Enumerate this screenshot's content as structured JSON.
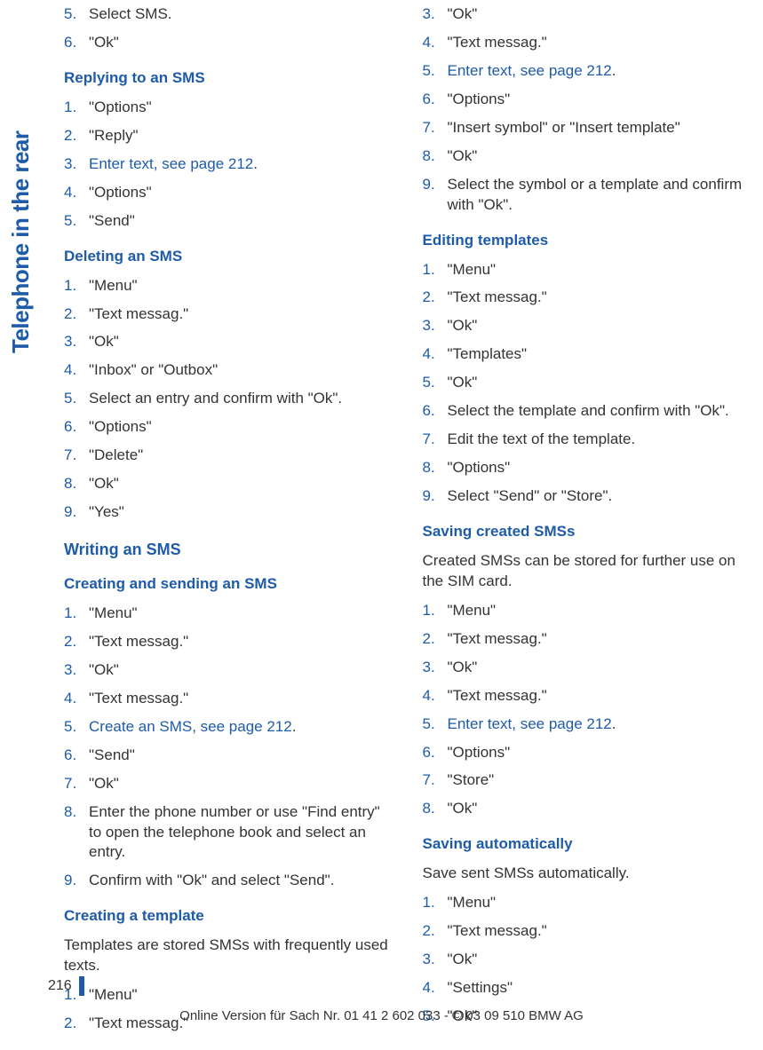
{
  "side_label": "Telephone in the rear",
  "col1": {
    "intro_list": [
      {
        "n": "5.",
        "t": "Select SMS."
      },
      {
        "n": "6.",
        "t": "\"Ok\""
      }
    ],
    "replying_heading": "Replying to an SMS",
    "replying_list": [
      {
        "n": "1.",
        "t": "\"Options\""
      },
      {
        "n": "2.",
        "t": "\"Reply\""
      },
      {
        "n": "3.",
        "link": "Enter text, see page 212",
        "suffix": "."
      },
      {
        "n": "4.",
        "t": "\"Options\""
      },
      {
        "n": "5.",
        "t": "\"Send\""
      }
    ],
    "deleting_heading": "Deleting an SMS",
    "deleting_list": [
      {
        "n": "1.",
        "t": "\"Menu\""
      },
      {
        "n": "2.",
        "t": "\"Text messag.\""
      },
      {
        "n": "3.",
        "t": "\"Ok\""
      },
      {
        "n": "4.",
        "t": "\"Inbox\" or \"Outbox\""
      },
      {
        "n": "5.",
        "t": "Select an entry and confirm with \"Ok\"."
      },
      {
        "n": "6.",
        "t": "\"Options\""
      },
      {
        "n": "7.",
        "t": "\"Delete\""
      },
      {
        "n": "8.",
        "t": "\"Ok\""
      },
      {
        "n": "9.",
        "t": "\"Yes\""
      }
    ],
    "writing_heading": "Writing an SMS",
    "creating_heading": "Creating and sending an SMS",
    "creating_list": [
      {
        "n": "1.",
        "t": "\"Menu\""
      },
      {
        "n": "2.",
        "t": "\"Text messag.\""
      },
      {
        "n": "3.",
        "t": "\"Ok\""
      },
      {
        "n": "4.",
        "t": "\"Text messag.\""
      },
      {
        "n": "5.",
        "link": "Create an SMS, see page 212",
        "suffix": "."
      },
      {
        "n": "6.",
        "t": "\"Send\""
      },
      {
        "n": "7.",
        "t": "\"Ok\""
      },
      {
        "n": "8.",
        "t": "Enter the phone number or use \"Find entry\" to open the telephone book and select an entry."
      },
      {
        "n": "9.",
        "t": "Confirm with \"Ok\" and select \"Send\"."
      }
    ],
    "template_heading": "Creating a template",
    "template_intro": "Templates are stored SMSs with frequently used texts.",
    "template_list": [
      {
        "n": "1.",
        "t": "\"Menu\""
      },
      {
        "n": "2.",
        "t": "\"Text messag.\""
      }
    ]
  },
  "col2": {
    "template_cont": [
      {
        "n": "3.",
        "t": "\"Ok\""
      },
      {
        "n": "4.",
        "t": "\"Text messag.\""
      },
      {
        "n": "5.",
        "link": "Enter text, see page 212",
        "suffix": "."
      },
      {
        "n": "6.",
        "t": "\"Options\""
      },
      {
        "n": "7.",
        "t": "\"Insert symbol\" or \"Insert template\""
      },
      {
        "n": "8.",
        "t": "\"Ok\""
      },
      {
        "n": "9.",
        "t": "Select the symbol or a template and confirm with \"Ok\"."
      }
    ],
    "editing_heading": "Editing templates",
    "editing_list": [
      {
        "n": "1.",
        "t": "\"Menu\""
      },
      {
        "n": "2.",
        "t": "\"Text messag.\""
      },
      {
        "n": "3.",
        "t": "\"Ok\""
      },
      {
        "n": "4.",
        "t": "\"Templates\""
      },
      {
        "n": "5.",
        "t": "\"Ok\""
      },
      {
        "n": "6.",
        "t": "Select the template and confirm with \"Ok\"."
      },
      {
        "n": "7.",
        "t": "Edit the text of the template."
      },
      {
        "n": "8.",
        "t": "\"Options\""
      },
      {
        "n": "9.",
        "t": "Select \"Send\" or \"Store\"."
      }
    ],
    "saving_heading": "Saving created SMSs",
    "saving_intro": "Created SMSs can be stored for further use on the SIM card.",
    "saving_list": [
      {
        "n": "1.",
        "t": "\"Menu\""
      },
      {
        "n": "2.",
        "t": "\"Text messag.\""
      },
      {
        "n": "3.",
        "t": "\"Ok\""
      },
      {
        "n": "4.",
        "t": "\"Text messag.\""
      },
      {
        "n": "5.",
        "link": "Enter text, see page 212",
        "suffix": "."
      },
      {
        "n": "6.",
        "t": "\"Options\""
      },
      {
        "n": "7.",
        "t": "\"Store\""
      },
      {
        "n": "8.",
        "t": "\"Ok\""
      }
    ],
    "auto_heading": "Saving automatically",
    "auto_intro": "Save sent SMSs automatically.",
    "auto_list": [
      {
        "n": "1.",
        "t": "\"Menu\""
      },
      {
        "n": "2.",
        "t": "\"Text messag.\""
      },
      {
        "n": "3.",
        "t": "\"Ok\""
      },
      {
        "n": "4.",
        "t": "\"Settings\""
      },
      {
        "n": "5.",
        "t": "\"Ok\""
      }
    ]
  },
  "page_number": "216",
  "footer_text": "Online Version für Sach Nr. 01 41 2 602 033 - © 03 09 510 BMW AG"
}
